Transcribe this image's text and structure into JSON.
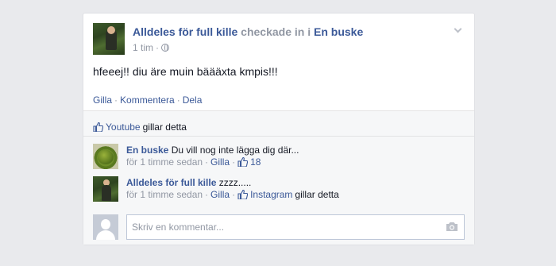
{
  "post": {
    "author": "Alldeles för full kille",
    "verb": "checkade in i",
    "place": "En buske",
    "time": "1 tim",
    "separator": "·",
    "text": "hfeeej!! diu äre muin bäääxta kmpis!!!",
    "actions": {
      "like": "Gilla",
      "comment": "Kommentera",
      "share": "Dela"
    }
  },
  "likes": {
    "page": "Youtube",
    "suffix": "gillar detta"
  },
  "comments": [
    {
      "author": "En buske",
      "text": "Du vill nog inte lägga dig där...",
      "time": "för 1 timme sedan",
      "like_label": "Gilla",
      "like_count": "18"
    },
    {
      "author": "Alldeles för full kille",
      "text": "zzzz.....",
      "time": "för 1 timme sedan",
      "like_label": "Gilla",
      "liker": "Instagram",
      "liker_suffix": "gillar detta"
    }
  ],
  "compose": {
    "placeholder": "Skriv en kommentar..."
  },
  "colors": {
    "link": "#3b5998",
    "muted": "#9197a3",
    "background": "#e9eaed"
  }
}
